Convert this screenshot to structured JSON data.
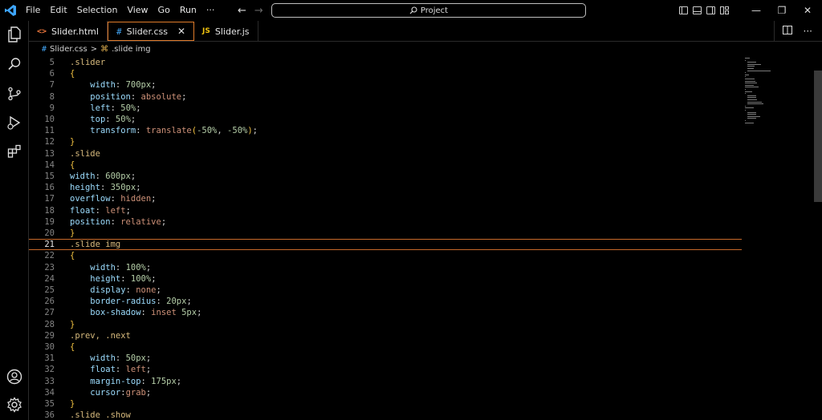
{
  "menu": [
    "File",
    "Edit",
    "Selection",
    "View",
    "Go",
    "Run",
    "···"
  ],
  "search": {
    "label": "Project"
  },
  "window_controls": {
    "minimize": "—",
    "restore": "❐",
    "close": "✕"
  },
  "tabs": [
    {
      "icon": "<>",
      "label": "Slider.html",
      "active": false
    },
    {
      "icon": "#",
      "label": "Slider.css",
      "active": true,
      "close": "✕"
    },
    {
      "icon": "JS",
      "label": "Slider.js",
      "active": false
    }
  ],
  "breadcrumb": {
    "file": "Slider.css",
    "separator": ">",
    "symbol": ".slide img"
  },
  "editor": {
    "current_line": 21,
    "lines": [
      {
        "n": "5",
        "text": ".slider"
      },
      {
        "n": "6",
        "text": "{"
      },
      {
        "n": "7",
        "text": "    width: 700px;"
      },
      {
        "n": "8",
        "text": "    position: absolute;"
      },
      {
        "n": "9",
        "text": "    left: 50%;"
      },
      {
        "n": "10",
        "text": "    top: 50%;"
      },
      {
        "n": "11",
        "text": "    transform: translate(-50%, -50%);"
      },
      {
        "n": "12",
        "text": "}"
      },
      {
        "n": "13",
        "text": ".slide"
      },
      {
        "n": "14",
        "text": "{"
      },
      {
        "n": "15",
        "text": "width: 600px;"
      },
      {
        "n": "16",
        "text": "height: 350px;"
      },
      {
        "n": "17",
        "text": "overflow: hidden;"
      },
      {
        "n": "18",
        "text": "float: left;"
      },
      {
        "n": "19",
        "text": "position: relative;"
      },
      {
        "n": "20",
        "text": "}"
      },
      {
        "n": "21",
        "text": ".slide img"
      },
      {
        "n": "22",
        "text": "{"
      },
      {
        "n": "23",
        "text": "    width: 100%;"
      },
      {
        "n": "24",
        "text": "    height: 100%;"
      },
      {
        "n": "25",
        "text": "    display: none;"
      },
      {
        "n": "26",
        "text": "    border-radius: 20px;"
      },
      {
        "n": "27",
        "text": "    box-shadow: inset 5px;"
      },
      {
        "n": "28",
        "text": "}"
      },
      {
        "n": "29",
        "text": ".prev, .next"
      },
      {
        "n": "30",
        "text": "{"
      },
      {
        "n": "31",
        "text": "    width: 50px;"
      },
      {
        "n": "32",
        "text": "    float: left;"
      },
      {
        "n": "33",
        "text": "    margin-top: 175px;"
      },
      {
        "n": "34",
        "text": "    cursor:grab;"
      },
      {
        "n": "35",
        "text": "}"
      },
      {
        "n": "36",
        "text": ".slide .show"
      }
    ]
  },
  "colors": {
    "accent": "#e07b2a",
    "selector": "#d7ba7d",
    "property": "#9cdcfe",
    "value": "#ce9178",
    "number": "#b5cea8",
    "brace": "#f0c040"
  }
}
